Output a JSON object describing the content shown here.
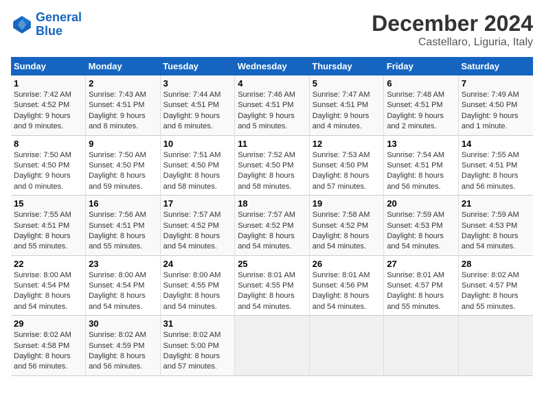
{
  "logo": {
    "line1": "General",
    "line2": "Blue"
  },
  "header": {
    "month": "December 2024",
    "location": "Castellaro, Liguria, Italy"
  },
  "weekdays": [
    "Sunday",
    "Monday",
    "Tuesday",
    "Wednesday",
    "Thursday",
    "Friday",
    "Saturday"
  ],
  "weeks": [
    [
      {
        "day": "1",
        "detail": "Sunrise: 7:42 AM\nSunset: 4:52 PM\nDaylight: 9 hours\nand 9 minutes."
      },
      {
        "day": "2",
        "detail": "Sunrise: 7:43 AM\nSunset: 4:51 PM\nDaylight: 9 hours\nand 8 minutes."
      },
      {
        "day": "3",
        "detail": "Sunrise: 7:44 AM\nSunset: 4:51 PM\nDaylight: 9 hours\nand 6 minutes."
      },
      {
        "day": "4",
        "detail": "Sunrise: 7:46 AM\nSunset: 4:51 PM\nDaylight: 9 hours\nand 5 minutes."
      },
      {
        "day": "5",
        "detail": "Sunrise: 7:47 AM\nSunset: 4:51 PM\nDaylight: 9 hours\nand 4 minutes."
      },
      {
        "day": "6",
        "detail": "Sunrise: 7:48 AM\nSunset: 4:51 PM\nDaylight: 9 hours\nand 2 minutes."
      },
      {
        "day": "7",
        "detail": "Sunrise: 7:49 AM\nSunset: 4:50 PM\nDaylight: 9 hours\nand 1 minute."
      }
    ],
    [
      {
        "day": "8",
        "detail": "Sunrise: 7:50 AM\nSunset: 4:50 PM\nDaylight: 9 hours\nand 0 minutes."
      },
      {
        "day": "9",
        "detail": "Sunrise: 7:50 AM\nSunset: 4:50 PM\nDaylight: 8 hours\nand 59 minutes."
      },
      {
        "day": "10",
        "detail": "Sunrise: 7:51 AM\nSunset: 4:50 PM\nDaylight: 8 hours\nand 58 minutes."
      },
      {
        "day": "11",
        "detail": "Sunrise: 7:52 AM\nSunset: 4:50 PM\nDaylight: 8 hours\nand 58 minutes."
      },
      {
        "day": "12",
        "detail": "Sunrise: 7:53 AM\nSunset: 4:50 PM\nDaylight: 8 hours\nand 57 minutes."
      },
      {
        "day": "13",
        "detail": "Sunrise: 7:54 AM\nSunset: 4:51 PM\nDaylight: 8 hours\nand 56 minutes."
      },
      {
        "day": "14",
        "detail": "Sunrise: 7:55 AM\nSunset: 4:51 PM\nDaylight: 8 hours\nand 56 minutes."
      }
    ],
    [
      {
        "day": "15",
        "detail": "Sunrise: 7:55 AM\nSunset: 4:51 PM\nDaylight: 8 hours\nand 55 minutes."
      },
      {
        "day": "16",
        "detail": "Sunrise: 7:56 AM\nSunset: 4:51 PM\nDaylight: 8 hours\nand 55 minutes."
      },
      {
        "day": "17",
        "detail": "Sunrise: 7:57 AM\nSunset: 4:52 PM\nDaylight: 8 hours\nand 54 minutes."
      },
      {
        "day": "18",
        "detail": "Sunrise: 7:57 AM\nSunset: 4:52 PM\nDaylight: 8 hours\nand 54 minutes."
      },
      {
        "day": "19",
        "detail": "Sunrise: 7:58 AM\nSunset: 4:52 PM\nDaylight: 8 hours\nand 54 minutes."
      },
      {
        "day": "20",
        "detail": "Sunrise: 7:59 AM\nSunset: 4:53 PM\nDaylight: 8 hours\nand 54 minutes."
      },
      {
        "day": "21",
        "detail": "Sunrise: 7:59 AM\nSunset: 4:53 PM\nDaylight: 8 hours\nand 54 minutes."
      }
    ],
    [
      {
        "day": "22",
        "detail": "Sunrise: 8:00 AM\nSunset: 4:54 PM\nDaylight: 8 hours\nand 54 minutes."
      },
      {
        "day": "23",
        "detail": "Sunrise: 8:00 AM\nSunset: 4:54 PM\nDaylight: 8 hours\nand 54 minutes."
      },
      {
        "day": "24",
        "detail": "Sunrise: 8:00 AM\nSunset: 4:55 PM\nDaylight: 8 hours\nand 54 minutes."
      },
      {
        "day": "25",
        "detail": "Sunrise: 8:01 AM\nSunset: 4:55 PM\nDaylight: 8 hours\nand 54 minutes."
      },
      {
        "day": "26",
        "detail": "Sunrise: 8:01 AM\nSunset: 4:56 PM\nDaylight: 8 hours\nand 54 minutes."
      },
      {
        "day": "27",
        "detail": "Sunrise: 8:01 AM\nSunset: 4:57 PM\nDaylight: 8 hours\nand 55 minutes."
      },
      {
        "day": "28",
        "detail": "Sunrise: 8:02 AM\nSunset: 4:57 PM\nDaylight: 8 hours\nand 55 minutes."
      }
    ],
    [
      {
        "day": "29",
        "detail": "Sunrise: 8:02 AM\nSunset: 4:58 PM\nDaylight: 8 hours\nand 56 minutes."
      },
      {
        "day": "30",
        "detail": "Sunrise: 8:02 AM\nSunset: 4:59 PM\nDaylight: 8 hours\nand 56 minutes."
      },
      {
        "day": "31",
        "detail": "Sunrise: 8:02 AM\nSunset: 5:00 PM\nDaylight: 8 hours\nand 57 minutes."
      },
      {
        "day": "",
        "detail": ""
      },
      {
        "day": "",
        "detail": ""
      },
      {
        "day": "",
        "detail": ""
      },
      {
        "day": "",
        "detail": ""
      }
    ]
  ]
}
